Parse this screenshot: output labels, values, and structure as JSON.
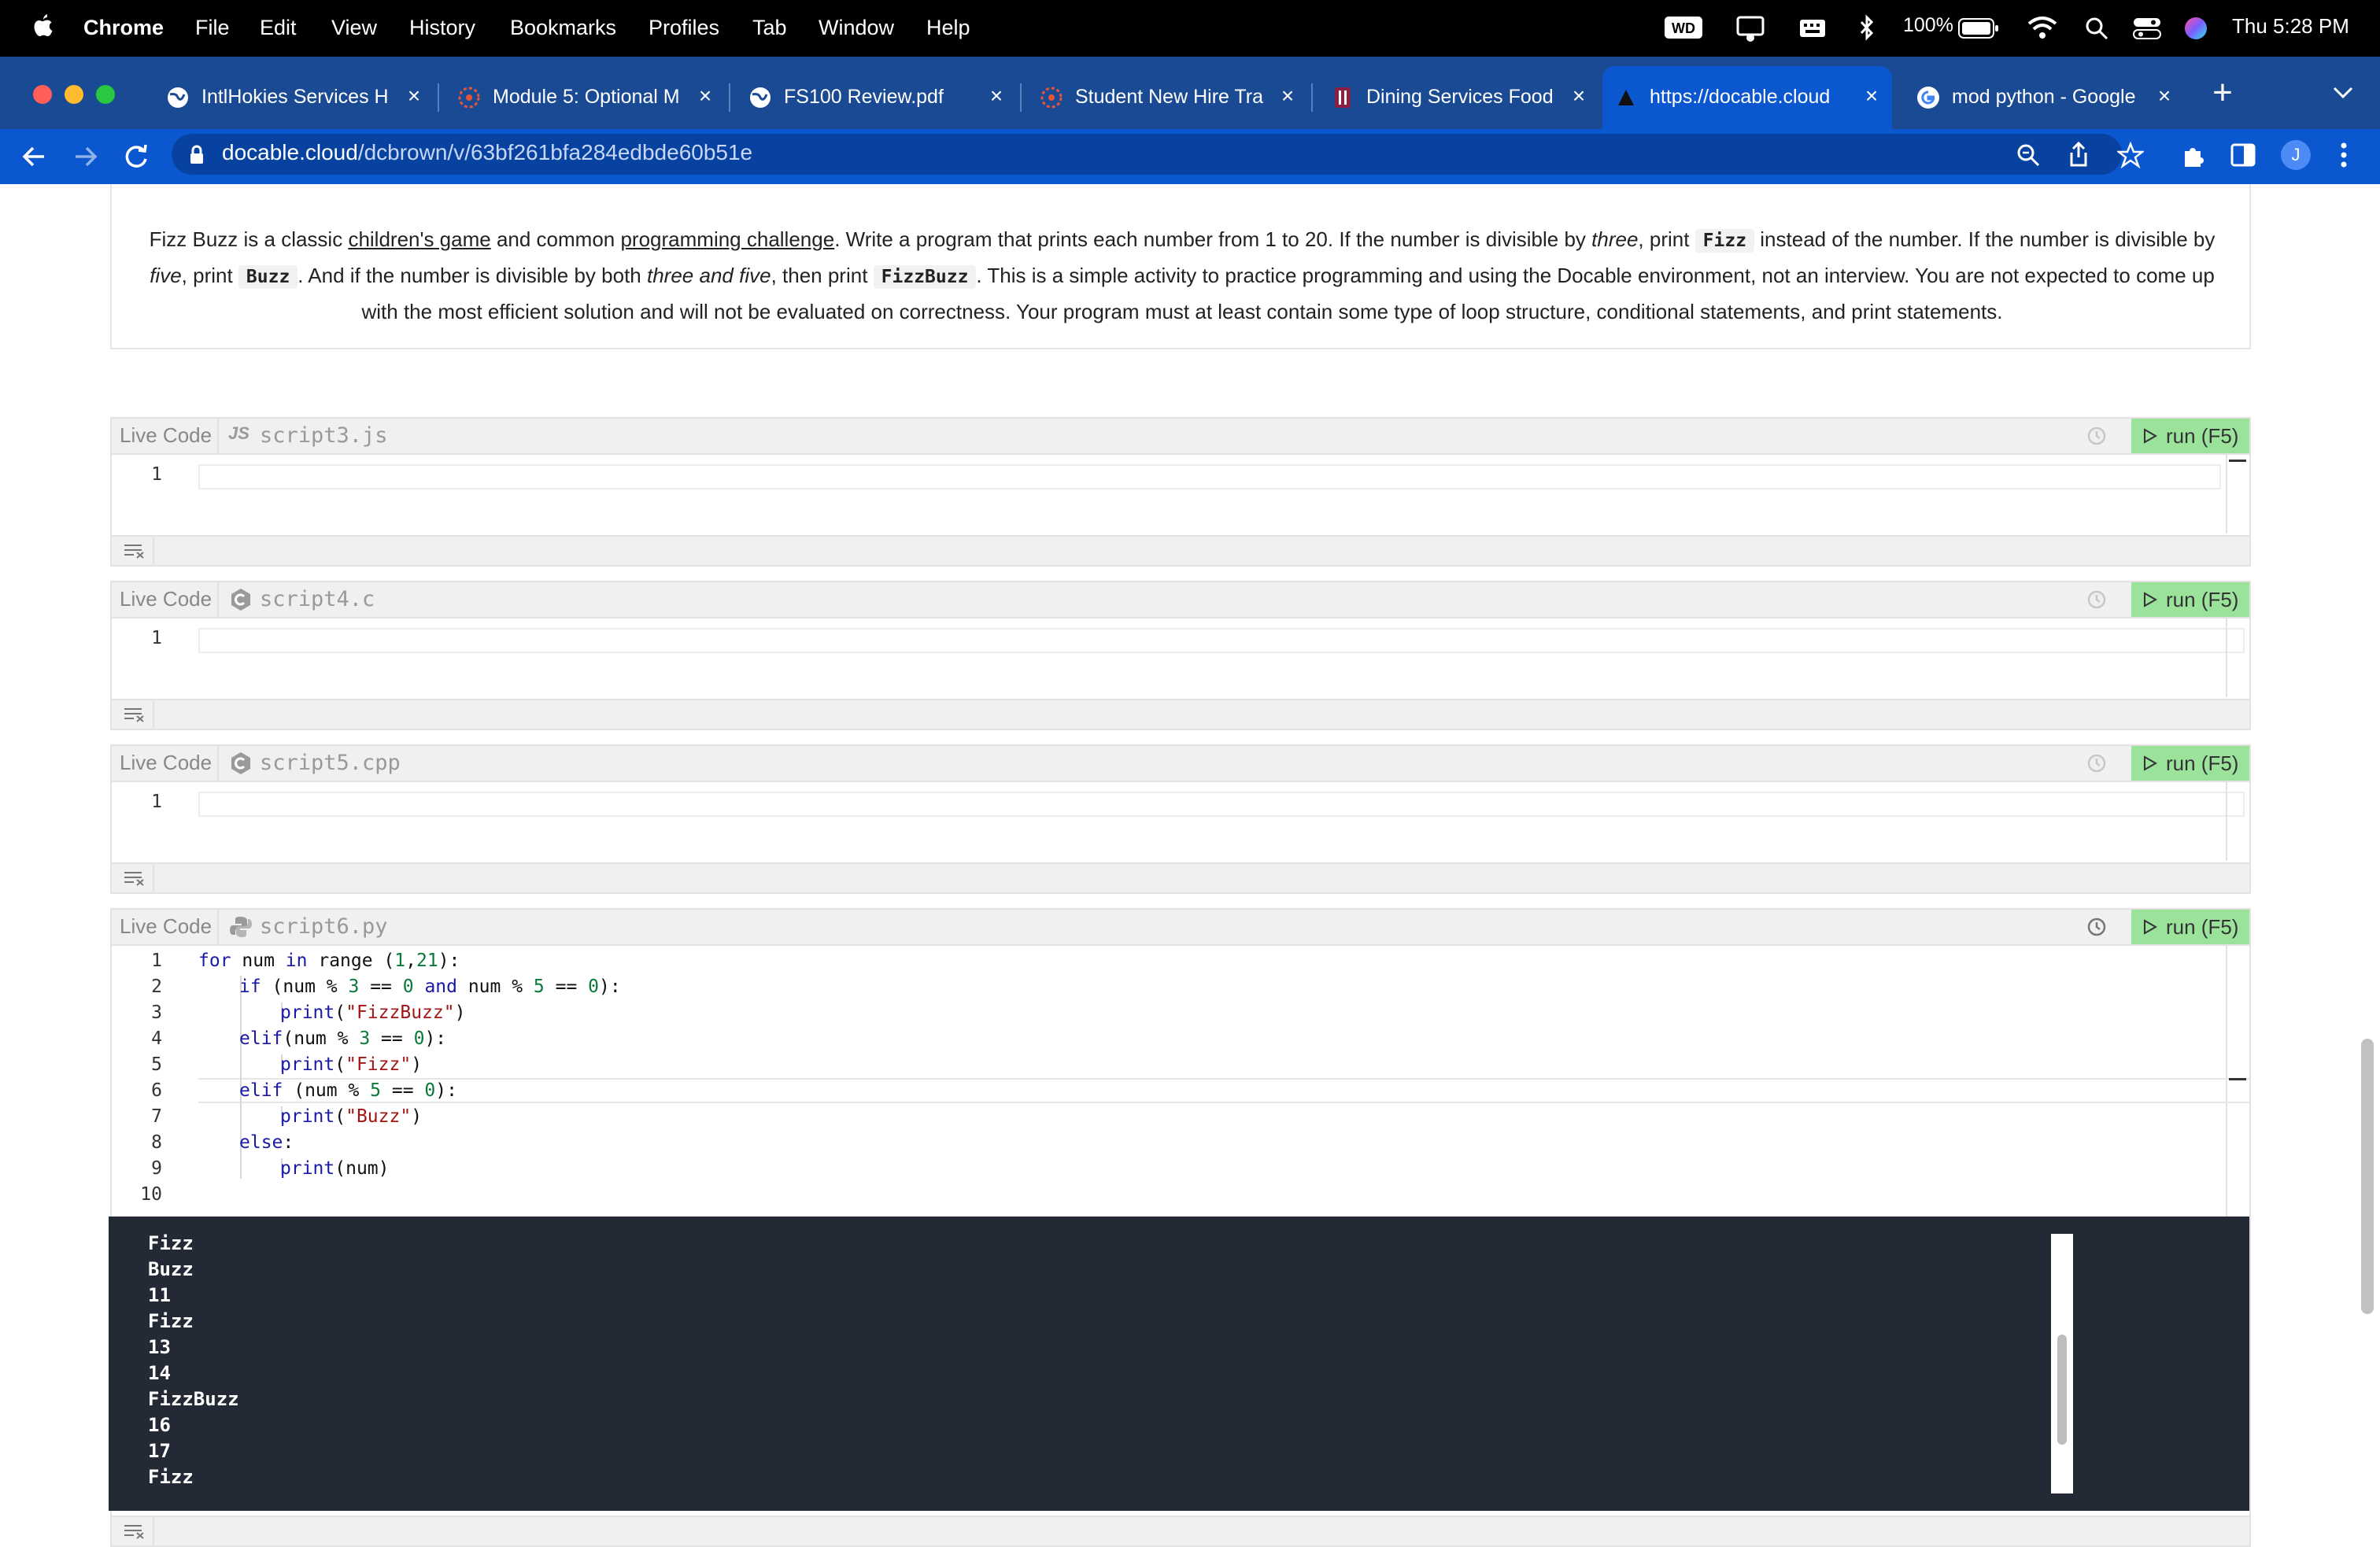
{
  "menubar": {
    "app": "Chrome",
    "items": [
      "File",
      "Edit",
      "View",
      "History",
      "Bookmarks",
      "Profiles",
      "Tab",
      "Window",
      "Help"
    ],
    "battery": "100%",
    "clock": "Thu 5:28 PM"
  },
  "tabs": [
    {
      "title": "IntlHokies Services H",
      "icon": "globe-icon"
    },
    {
      "title": "Module 5: Optional M",
      "icon": "canvas-icon"
    },
    {
      "title": "FS100 Review.pdf",
      "icon": "globe-icon"
    },
    {
      "title": "Student New Hire Tra",
      "icon": "canvas-icon"
    },
    {
      "title": "Dining Services Food",
      "icon": "vt-icon"
    },
    {
      "title": "https://docable.cloud",
      "icon": "docable-icon",
      "active": true
    },
    {
      "title": "mod python - Google",
      "icon": "google-icon"
    }
  ],
  "toolbar": {
    "url_host": "docable.cloud",
    "url_path": "/dcbrown/v/63bf261bfa284edbde60b51e",
    "profile_initial": "J"
  },
  "prose": {
    "t1": "Fizz Buzz is a classic ",
    "link1": "children's game",
    "t2": " and common ",
    "link2": "programming challenge",
    "t3": ". Write a program that prints each number from 1 to 20. If the number is divisible by ",
    "three": "three",
    "t4": ", print ",
    "fizz": "Fizz",
    "t5": " instead of the number. If the number is divisible by ",
    "five": "five",
    "t6": ", print ",
    "buzz": "Buzz",
    "t7": ". And if the number is divisible by both ",
    "threefive": "three and five",
    "t8": ", then print ",
    "fizzbuzz": "FizzBuzz",
    "t9": ". This is a simple activity to practice programming and using the Docable environment, not an interview. You are not expected to come up with the most efficient solution and will not be evaluated on correctness. Your program must at least contain some type of loop structure, conditional statements, and print statements."
  },
  "cells": [
    {
      "live": "Live Code",
      "lang": "JS",
      "file": "script3.js",
      "run": "run (F5)",
      "line": "1"
    },
    {
      "live": "Live Code",
      "lang": "C",
      "file": "script4.c",
      "run": "run (F5)",
      "line": "1"
    },
    {
      "live": "Live Code",
      "lang": "C",
      "file": "script5.cpp",
      "run": "run (F5)",
      "line": "1"
    },
    {
      "live": "Live Code",
      "lang": "py",
      "file": "script6.py",
      "run": "run (F5)"
    }
  ],
  "python": {
    "line_numbers": [
      "1",
      "2",
      "3",
      "4",
      "5",
      "6",
      "7",
      "8",
      "9",
      "10"
    ],
    "l1": {
      "a": "for",
      "b": " num ",
      "c": "in",
      "d": " range (",
      "e": "1",
      "f": ",",
      "g": "21",
      "h": "):"
    },
    "l2": {
      "a": "if",
      "b": " (num % ",
      "c": "3",
      "d": " == ",
      "e": "0",
      "f": " and",
      "g": " num % ",
      "h": "5",
      "i": " == ",
      "j": "0",
      "k": "):"
    },
    "l3": {
      "a": "print",
      "b": "(",
      "c": "\"FizzBuzz\"",
      "d": ")"
    },
    "l4": {
      "a": "elif",
      "b": "(num % ",
      "c": "3",
      "d": " == ",
      "e": "0",
      "f": "):"
    },
    "l5": {
      "a": "print",
      "b": "(",
      "c": "\"Fizz\"",
      "d": ")"
    },
    "l6": {
      "a": "elif",
      "b": " (num % ",
      "c": "5",
      "d": " == ",
      "e": "0",
      "f": "):"
    },
    "l7": {
      "a": "print",
      "b": "(",
      "c": "\"Buzz\"",
      "d": ")"
    },
    "l8": {
      "a": "else",
      "b": ":"
    },
    "l9": {
      "a": "print",
      "b": "(num)"
    }
  },
  "output": [
    "Fizz",
    "Buzz",
    "11",
    "Fizz",
    "13",
    "14",
    "FizzBuzz",
    "16",
    "17",
    "Fizz"
  ],
  "colors": {
    "run_green": "#9be39b",
    "chrome_blue": "#0b57d0",
    "output_bg": "#232a35"
  }
}
